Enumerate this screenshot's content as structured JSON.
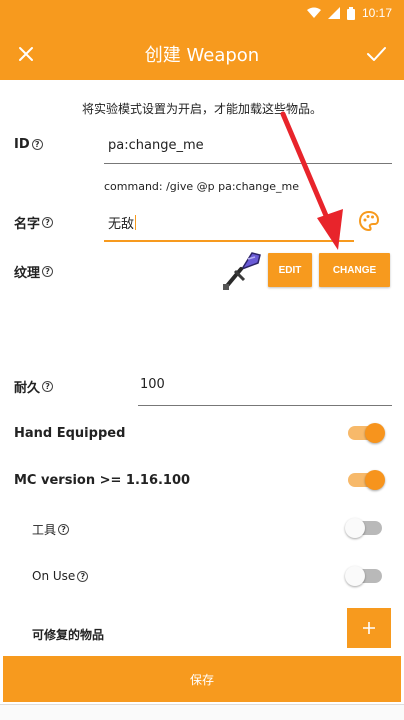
{
  "status_bar": {
    "time": "10:17"
  },
  "app_bar": {
    "title": "创建 Weapon",
    "close_icon": "close-icon",
    "confirm_icon": "check-icon"
  },
  "notice": "将实验模式设置为开启，才能加载这些物品。",
  "form": {
    "id": {
      "label": "ID",
      "value": "pa:change_me",
      "command_hint": "command: /give @p pa:change_me"
    },
    "name": {
      "label": "名字",
      "value": "无敌"
    },
    "texture": {
      "label": "纹理",
      "edit_label": "EDIT",
      "change_label": "CHANGE"
    },
    "durability": {
      "label": "耐久",
      "value": "100"
    },
    "hand_equipped": {
      "label": "Hand Equipped",
      "on": true
    },
    "mc_version": {
      "label": "MC version >= 1.16.100",
      "on": true
    },
    "tool": {
      "label": "工具",
      "on": false
    },
    "on_use": {
      "label": "On Use",
      "on": false
    },
    "repairable": {
      "label": "可修复的物品",
      "add_label": "+"
    }
  },
  "save_label": "保存",
  "colors": {
    "accent": "#f79a1e",
    "arrow": "#e8242b"
  }
}
